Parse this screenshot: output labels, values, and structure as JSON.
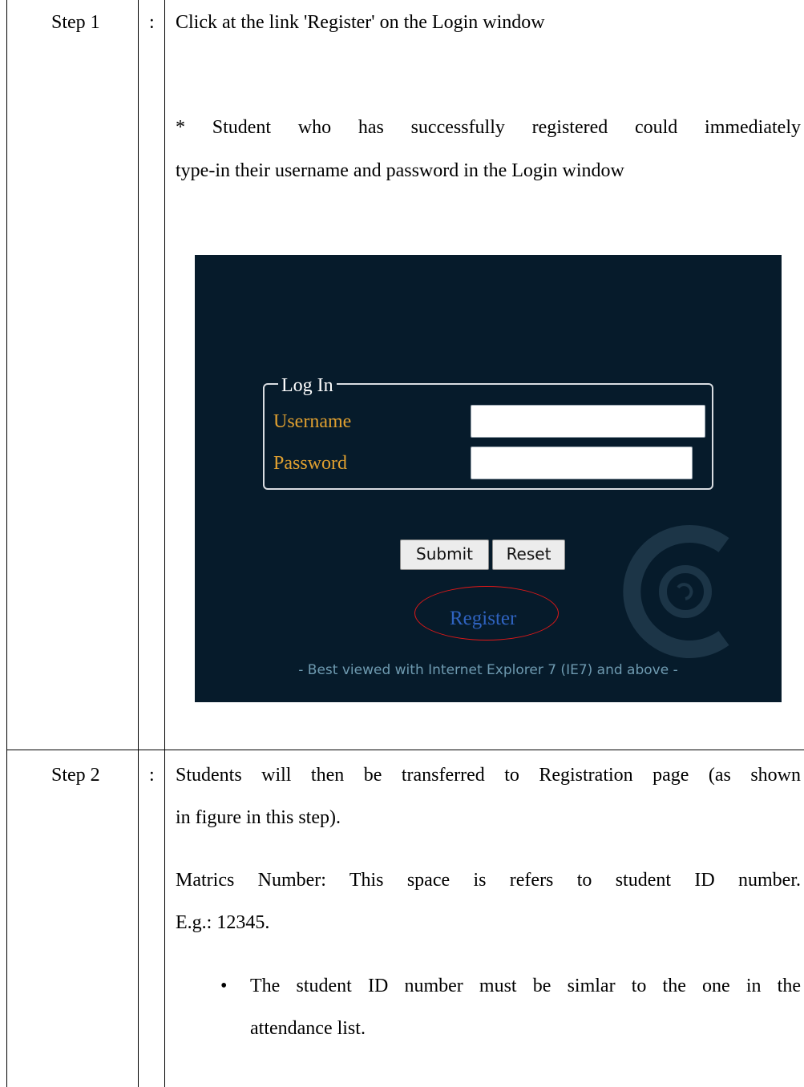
{
  "steps": [
    {
      "label": "Step 1",
      "separator": ":",
      "instruction": "Click at the link 'Register' on the Login window",
      "note_line1": "* Student who has successfully registered could immediately",
      "note_line2": "type-in their username and password in the Login window"
    },
    {
      "label": "Step 2",
      "separator": ":",
      "line1": "Students will then be transferred to Registration page (as shown",
      "line2": "in figure in this step).",
      "matrics_line1": "Matrics Number: This space is refers to student ID number.",
      "matrics_line2": "E.g.: 12345.",
      "bullet_symbol": "•",
      "bullet_line1": "The student ID number must be simlar to the one in the",
      "bullet_line2": "attendance list."
    }
  ],
  "login_window": {
    "legend": "Log In",
    "username_label": "Username",
    "password_label": "Password",
    "submit_label": "Submit",
    "reset_label": "Reset",
    "register_link": "Register",
    "footer": "- Best viewed with Internet Explorer 7 (IE7) and above -",
    "logo_icon": "circular-logo-icon",
    "colors": {
      "background": "#061b2b",
      "label": "#e0a030",
      "link": "#2f63c0",
      "highlight_ring": "#e01818"
    }
  }
}
